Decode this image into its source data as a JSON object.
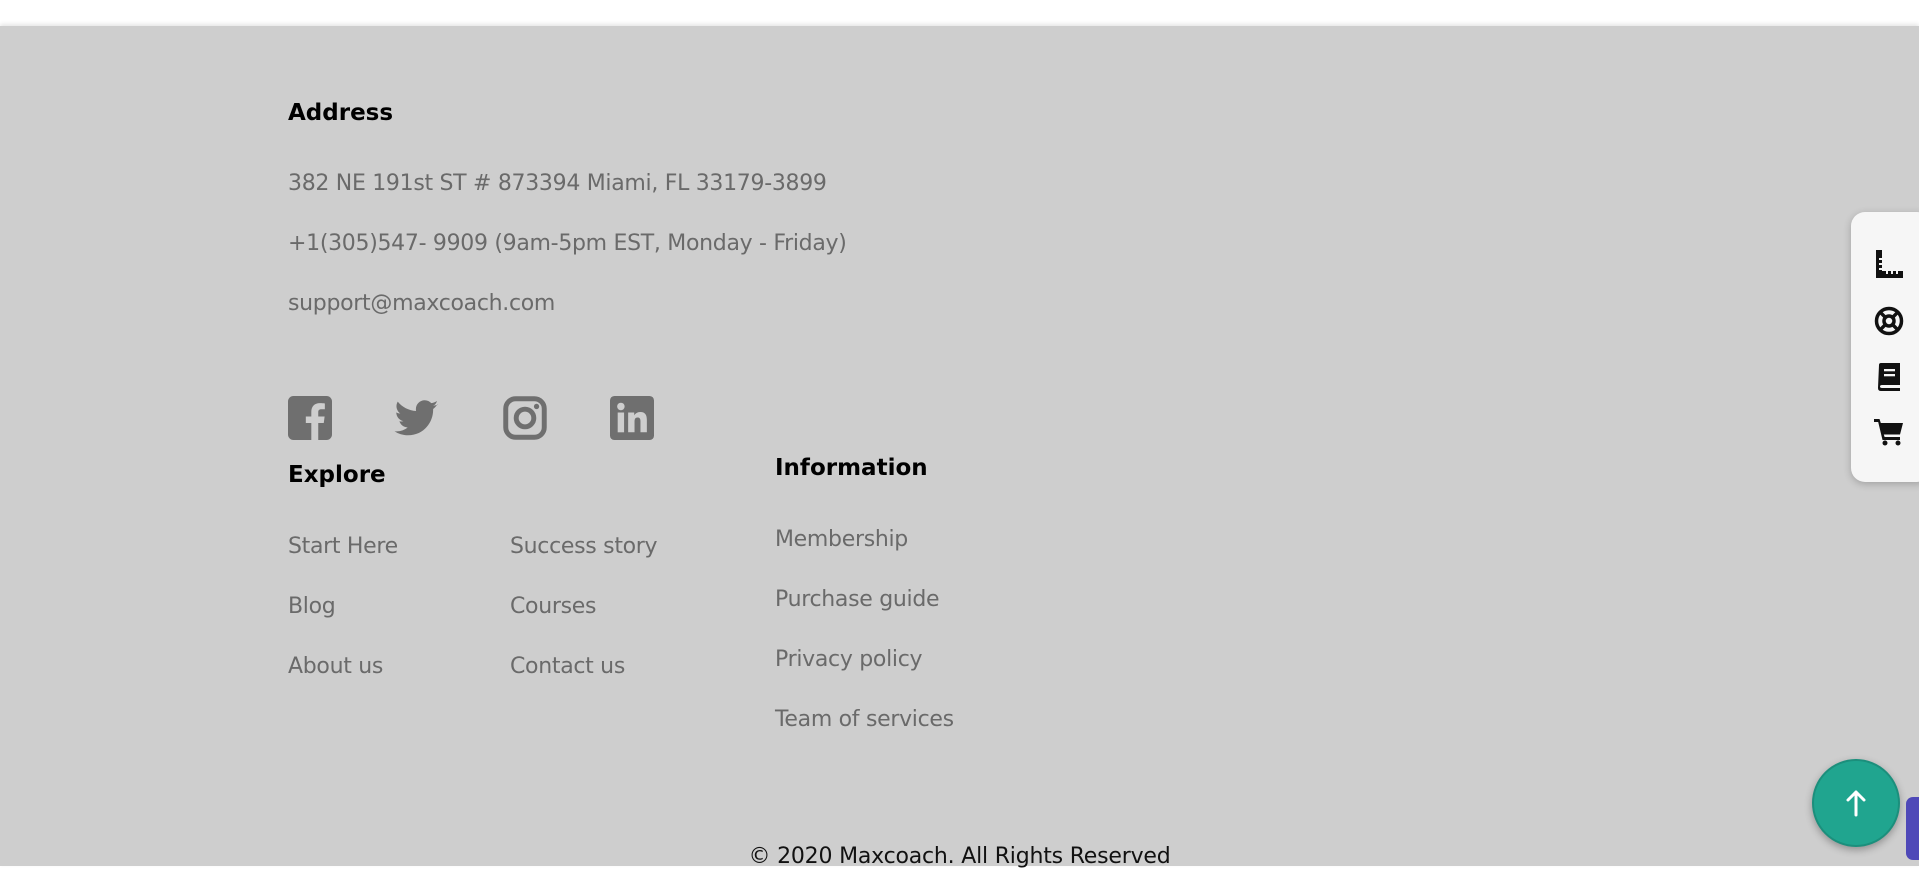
{
  "address": {
    "heading": "Address",
    "street": "382 NE 191st ST # 873394 Miami, FL 33179-3899",
    "phone": "+1(305)547- 9909 (9am-5pm EST, Monday - Friday)",
    "email": "support@maxcoach.com"
  },
  "social": [
    {
      "icon": "facebook-icon"
    },
    {
      "icon": "twitter-icon"
    },
    {
      "icon": "instagram-icon"
    },
    {
      "icon": "linkedin-icon"
    }
  ],
  "explore": {
    "heading": "Explore",
    "links": [
      "Start Here",
      "Success story",
      "Blog",
      "Courses",
      "About us",
      "Contact us"
    ]
  },
  "information": {
    "heading": "Information",
    "links": [
      "Membership",
      "Purchase guide",
      "Privacy policy",
      "Team of services"
    ]
  },
  "copyright": "© 2020 Maxcoach. All Rights Reserved",
  "side_toolbar": [
    {
      "icon": "ruler-icon"
    },
    {
      "icon": "support-icon"
    },
    {
      "icon": "book-icon"
    },
    {
      "icon": "cart-icon"
    }
  ],
  "back_to_top": {
    "icon": "arrow-up-icon"
  },
  "colors": {
    "footer_bg": "#cecece",
    "link_text": "#6a6a6a",
    "heading_text": "#000000",
    "accent": "#20a58f",
    "scroll_thumb": "#4e48b8"
  }
}
